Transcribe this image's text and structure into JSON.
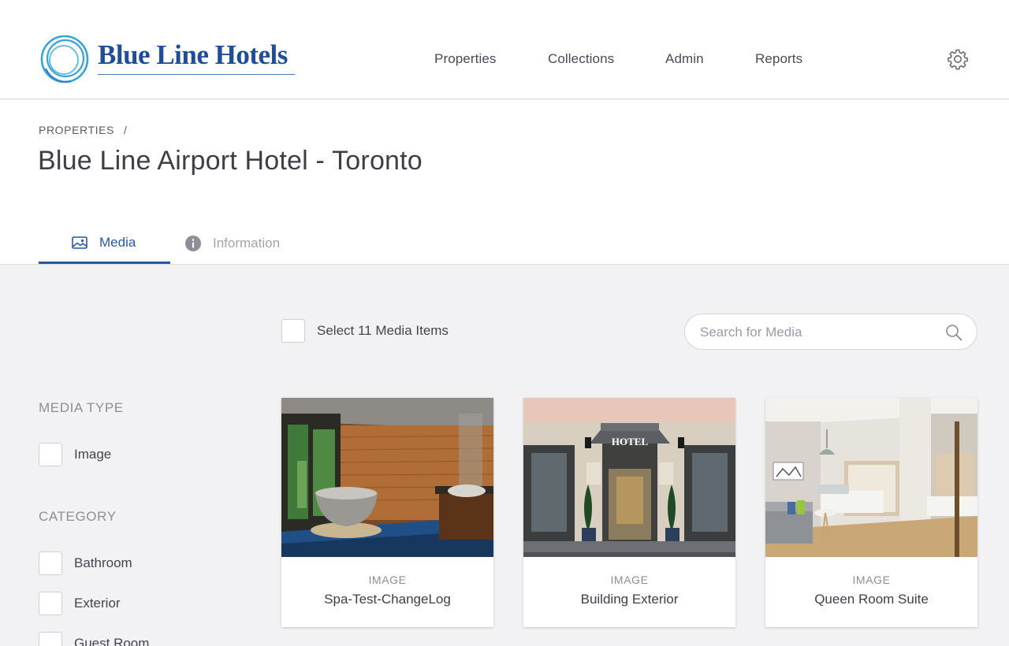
{
  "brand": {
    "name": "Blue Line Hotels",
    "primary_color": "#1f4e96",
    "accent_color": "#2a57a5"
  },
  "nav": {
    "items": [
      {
        "label": "Properties"
      },
      {
        "label": "Collections"
      },
      {
        "label": "Admin"
      },
      {
        "label": "Reports"
      }
    ],
    "settings_icon": "gear-icon"
  },
  "breadcrumb": {
    "parent": "PROPERTIES",
    "separator": "/"
  },
  "page": {
    "title": "Blue Line Airport Hotel - Toronto"
  },
  "tabs": [
    {
      "label": "Media",
      "icon": "image-icon",
      "active": true
    },
    {
      "label": "Information",
      "icon": "info-icon",
      "active": false
    }
  ],
  "toolbar": {
    "select_all_label": "Select 11 Media Items",
    "search_placeholder": "Search for Media",
    "search_value": ""
  },
  "filters": {
    "media_type": {
      "heading": "MEDIA TYPE",
      "options": [
        {
          "label": "Image",
          "checked": false
        }
      ]
    },
    "category": {
      "heading": "CATEGORY",
      "options": [
        {
          "label": "Bathroom",
          "checked": false
        },
        {
          "label": "Exterior",
          "checked": false
        },
        {
          "label": "Guest Room",
          "checked": false
        }
      ]
    }
  },
  "media": [
    {
      "type": "IMAGE",
      "name": "Spa-Test-ChangeLog"
    },
    {
      "type": "IMAGE",
      "name": "Building Exterior",
      "sign_text": "HOTEL"
    },
    {
      "type": "IMAGE",
      "name": "Queen Room Suite"
    }
  ]
}
